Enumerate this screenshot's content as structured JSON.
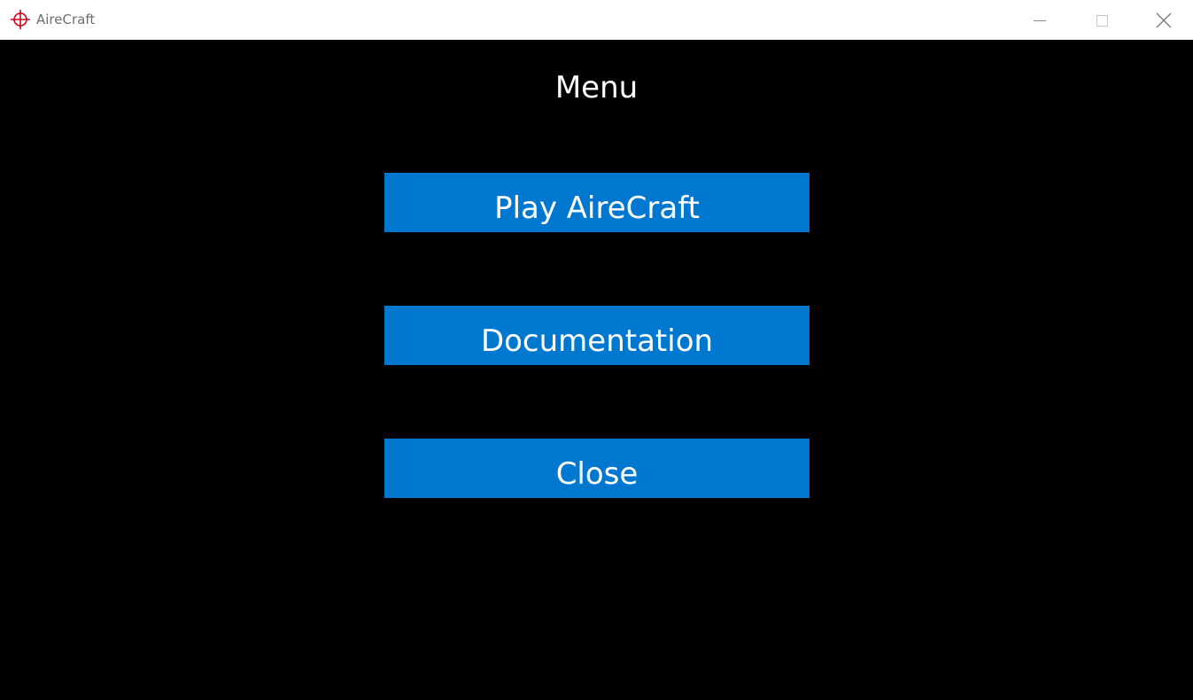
{
  "window": {
    "title": "AireCraft",
    "icon": "crosshair-icon",
    "icon_color": "#d0021b",
    "controls": {
      "minimize": "minimize-icon",
      "maximize": "maximize-icon",
      "close": "close-icon"
    }
  },
  "menu": {
    "title": "Menu",
    "button_color": "#0078d0",
    "buttons": [
      {
        "label": "Play AireCraft"
      },
      {
        "label": "Documentation"
      },
      {
        "label": "Close"
      }
    ]
  }
}
